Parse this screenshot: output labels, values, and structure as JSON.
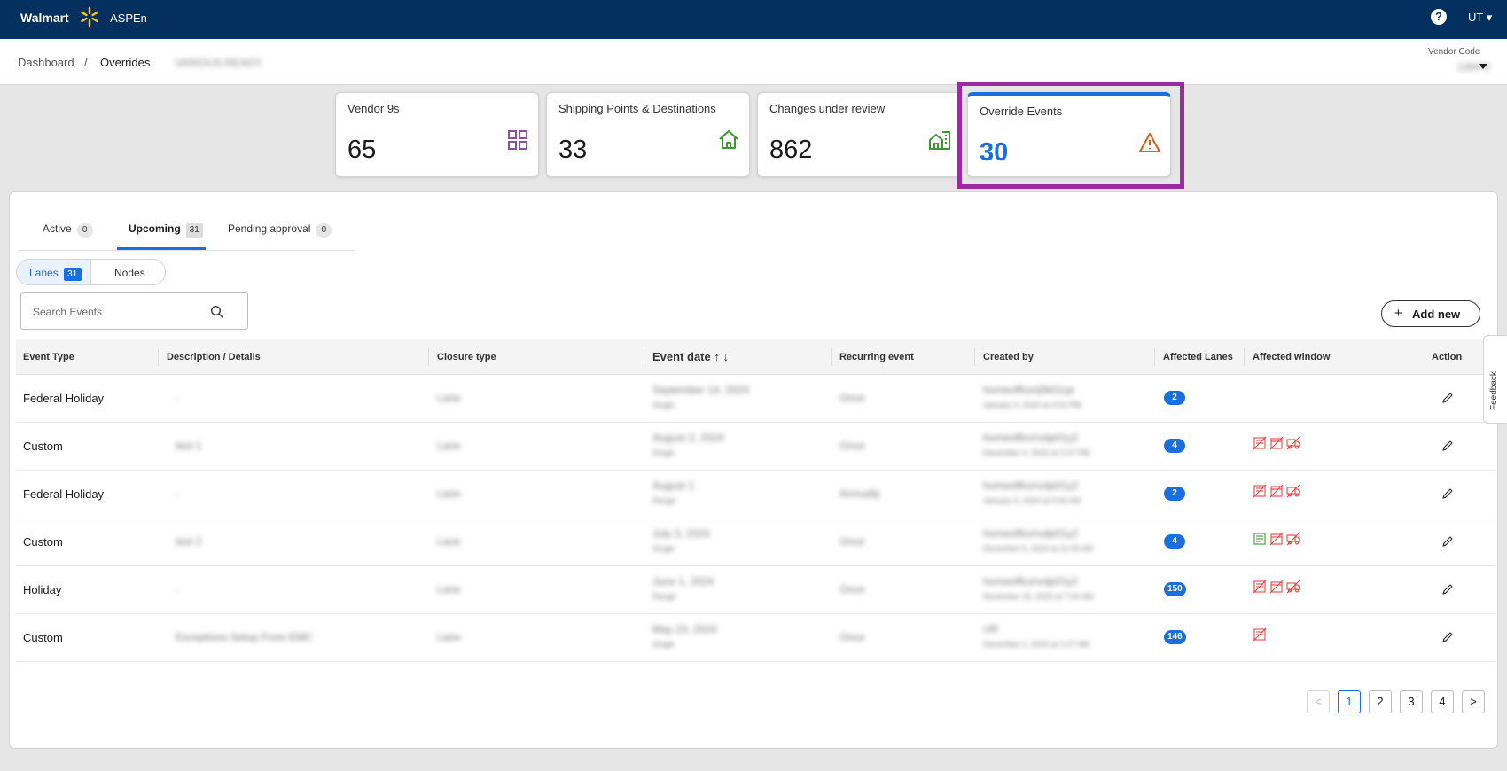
{
  "topbar": {
    "brand": "Walmart",
    "app": "ASPEn",
    "help_glyph": "?",
    "user": "UT"
  },
  "breadcrumb": {
    "dashboard": "Dashboard",
    "separator": "/",
    "current": "Overrides",
    "vendor_name": "VARIOUS-READY"
  },
  "vendor_code": {
    "label": "Vendor Code",
    "value": "128470"
  },
  "stats": [
    {
      "title": "Vendor 9s",
      "value": "65",
      "icon": "grid-icon"
    },
    {
      "title": "Shipping Points & Destinations",
      "value": "33",
      "icon": "home-icon"
    },
    {
      "title": "Changes under review",
      "value": "862",
      "icon": "building-icon"
    },
    {
      "title": "Override Events",
      "value": "30",
      "icon": "warning-icon"
    }
  ],
  "tabs": [
    {
      "label": "Active",
      "count": "0"
    },
    {
      "label": "Upcoming",
      "count": "31"
    },
    {
      "label": "Pending approval",
      "count": "0"
    }
  ],
  "toggle": {
    "lanes": "Lanes",
    "lanes_count": "31",
    "nodes": "Nodes"
  },
  "search": {
    "placeholder": "Search Events"
  },
  "add_new": {
    "label": "Add new",
    "plus": "+"
  },
  "table": {
    "headers": {
      "event_type": "Event Type",
      "description": "Description / Details",
      "closure": "Closure type",
      "event_date": "Event date ↑ ↓",
      "recurring": "Recurring event",
      "created_by": "Created by",
      "affected_lanes": "Affected Lanes",
      "affected_window": "Affected window",
      "action": "Action"
    },
    "rows": [
      {
        "type": "Federal Holiday",
        "desc": "-",
        "closure": "Lane",
        "date": "September 14, 2024",
        "date_sub": "Single",
        "recurring": "Once",
        "created": "homeoffice\\j0k01qx",
        "created_sub": "January 3, 2024 at 4:02 PM",
        "lanes": "2",
        "windows": []
      },
      {
        "type": "Custom",
        "desc": "test 1",
        "closure": "Lane",
        "date": "August 2, 2024",
        "date_sub": "Single",
        "recurring": "Once",
        "created": "homeoffice\\vdp01y2",
        "created_sub": "December 4, 2023 at 2:47 PM",
        "lanes": "4",
        "windows": [
          "red",
          "red",
          "red"
        ]
      },
      {
        "type": "Federal Holiday",
        "desc": "-",
        "closure": "Lane",
        "date": "August 1",
        "date_sub": "Range",
        "recurring": "Annually",
        "created": "homeoffice\\vdp01y2",
        "created_sub": "January 4, 2024 at 9:06 AM",
        "lanes": "2",
        "windows": [
          "red",
          "red",
          "red"
        ]
      },
      {
        "type": "Custom",
        "desc": "test 2",
        "closure": "Lane",
        "date": "July 3, 2024",
        "date_sub": "Single",
        "recurring": "Once",
        "created": "homeoffice\\vdp01y2",
        "created_sub": "December 5, 2023 at 11:06 AM",
        "lanes": "4",
        "windows": [
          "green",
          "red",
          "red"
        ]
      },
      {
        "type": "Holiday",
        "desc": "-",
        "closure": "Lane",
        "date": "June 1, 2024",
        "date_sub": "Range",
        "recurring": "Once",
        "created": "homeoffice\\vdp01y2",
        "created_sub": "November 16, 2023 at 7:04 AM",
        "lanes": "150",
        "windows": [
          "red",
          "red",
          "red"
        ]
      },
      {
        "type": "Custom",
        "desc": "Exceptions Setup From EMC",
        "closure": "Lane",
        "date": "May 23, 2024",
        "date_sub": "Single",
        "recurring": "Once",
        "created": "UR",
        "created_sub": "December 1, 2023 at 1:07 AM",
        "lanes": "146",
        "windows": [
          "red"
        ]
      }
    ]
  },
  "pagination": {
    "prev": "<",
    "pages": [
      "1",
      "2",
      "3",
      "4"
    ],
    "next": ">"
  },
  "feedback": "Feedback",
  "colors": {
    "header": "#04305f",
    "accent": "#1a6fe0",
    "highlight": "#9b2aa3",
    "warning": "#e05c17",
    "success": "#3a9a2f",
    "alert": "#e64545"
  }
}
